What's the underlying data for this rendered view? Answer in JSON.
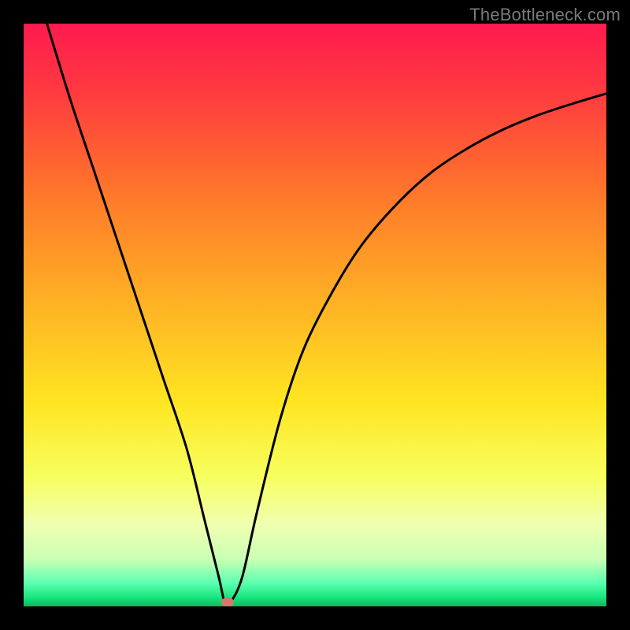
{
  "watermark": "TheBottleneck.com",
  "chart_data": {
    "type": "line",
    "title": "",
    "xlabel": "",
    "ylabel": "",
    "xlim": [
      0,
      100
    ],
    "ylim": [
      0,
      100
    ],
    "grid": false,
    "legend": false,
    "gradient_stops": [
      {
        "offset": 0,
        "color": "#ff1a4f"
      },
      {
        "offset": 12,
        "color": "#ff3b3f"
      },
      {
        "offset": 30,
        "color": "#ff7a2a"
      },
      {
        "offset": 50,
        "color": "#ffb824"
      },
      {
        "offset": 65,
        "color": "#ffe522"
      },
      {
        "offset": 78,
        "color": "#f7ff60"
      },
      {
        "offset": 86,
        "color": "#f0ffb0"
      },
      {
        "offset": 92,
        "color": "#c8ffb4"
      },
      {
        "offset": 96,
        "color": "#5bffb0"
      },
      {
        "offset": 98.5,
        "color": "#17e57d"
      },
      {
        "offset": 100,
        "color": "#0fb85f"
      }
    ],
    "series": [
      {
        "name": "curve",
        "stroke": "#000000",
        "stroke_width": 3,
        "x": [
          4.0,
          8,
          12,
          16,
          20,
          24,
          28,
          31,
          33.5,
          34.5,
          35.5,
          37.5,
          40,
          44,
          48,
          53,
          58,
          64,
          70,
          76,
          82,
          88,
          94,
          100
        ],
        "values": [
          100,
          87,
          75,
          63,
          51,
          39,
          27,
          15,
          5,
          0.7,
          0.7,
          5,
          16,
          32,
          44,
          54,
          62,
          69,
          74.5,
          78.5,
          81.7,
          84.2,
          86.2,
          88
        ]
      }
    ],
    "marker": {
      "x": 35.0,
      "y": 0.7,
      "rx": 1.1,
      "ry": 0.85,
      "fill": "#cf7b6f"
    }
  }
}
